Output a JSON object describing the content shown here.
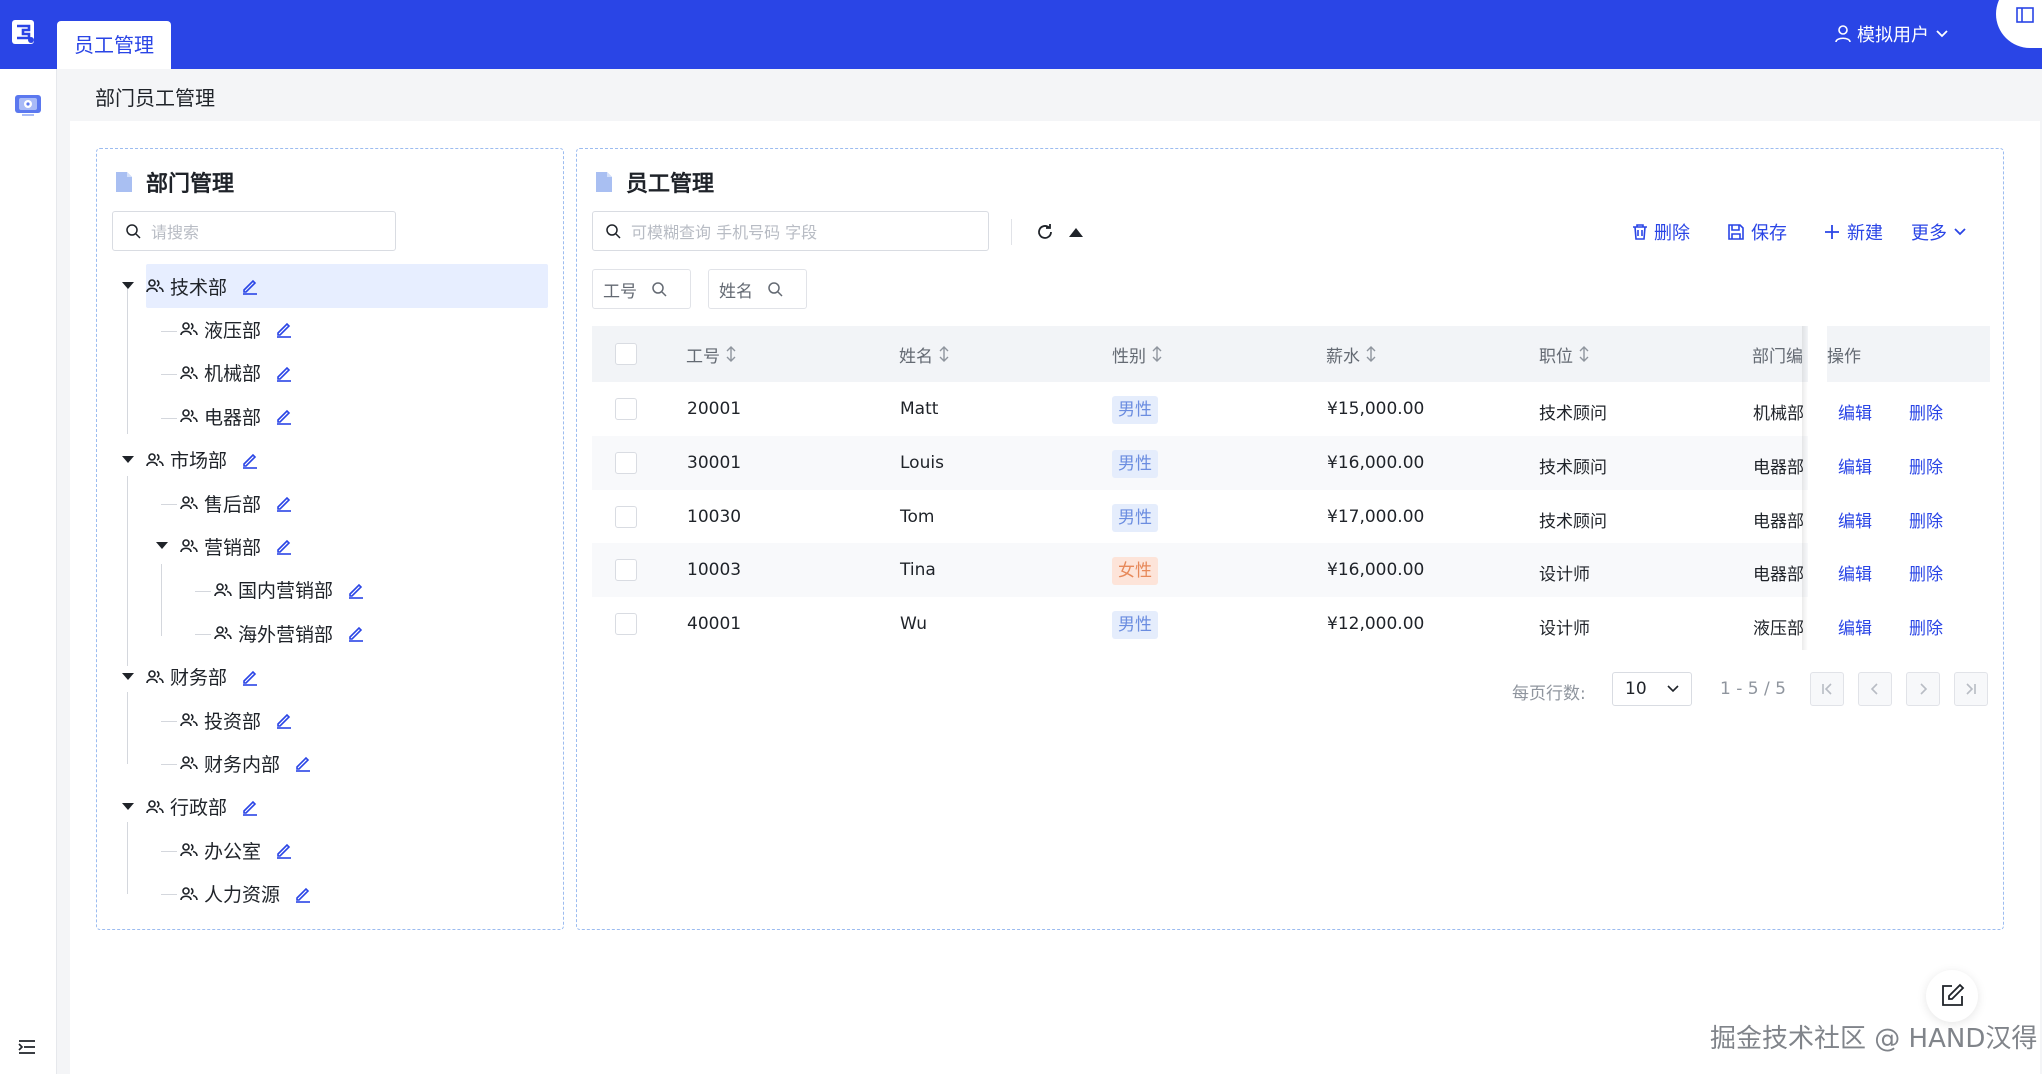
{
  "header": {
    "tab": "员工管理",
    "user": "模拟用户"
  },
  "breadcrumb": "部门员工管理",
  "dept_panel": {
    "title": "部门管理",
    "search_placeholder": "请搜索",
    "tree": [
      {
        "label": "技术部",
        "level": 0,
        "expanded": true,
        "selected": true
      },
      {
        "label": "液压部",
        "level": 1
      },
      {
        "label": "机械部",
        "level": 1
      },
      {
        "label": "电器部",
        "level": 1
      },
      {
        "label": "市场部",
        "level": 0,
        "expanded": true
      },
      {
        "label": "售后部",
        "level": 1
      },
      {
        "label": "营销部",
        "level": 1,
        "expanded": true
      },
      {
        "label": "国内营销部",
        "level": 2
      },
      {
        "label": "海外营销部",
        "level": 2
      },
      {
        "label": "财务部",
        "level": 0,
        "expanded": true
      },
      {
        "label": "投资部",
        "level": 1
      },
      {
        "label": "财务内部",
        "level": 1
      },
      {
        "label": "行政部",
        "level": 0,
        "expanded": true
      },
      {
        "label": "办公室",
        "level": 1
      },
      {
        "label": "人力资源",
        "level": 1
      }
    ]
  },
  "emp_panel": {
    "title": "员工管理",
    "search_placeholder": "可模糊查询 手机号码 字段",
    "toolbar": {
      "delete": "删除",
      "save": "保存",
      "new": "新建",
      "more": "更多"
    },
    "filters": {
      "id": "工号",
      "name": "姓名"
    },
    "columns": {
      "id": "工号",
      "name": "姓名",
      "gender": "性别",
      "salary": "薪水",
      "position": "职位",
      "dept": "部门编",
      "actions": "操作"
    },
    "rows": [
      {
        "id": "20001",
        "name": "Matt",
        "gender": "男性",
        "salary": "¥15,000.00",
        "position": "技术顾问",
        "dept": "机械部",
        "edit": "编辑",
        "delete": "删除"
      },
      {
        "id": "30001",
        "name": "Louis",
        "gender": "男性",
        "salary": "¥16,000.00",
        "position": "技术顾问",
        "dept": "电器部",
        "edit": "编辑",
        "delete": "删除"
      },
      {
        "id": "10030",
        "name": "Tom",
        "gender": "男性",
        "salary": "¥17,000.00",
        "position": "技术顾问",
        "dept": "电器部",
        "edit": "编辑",
        "delete": "删除"
      },
      {
        "id": "10003",
        "name": "Tina",
        "gender": "女性",
        "salary": "¥16,000.00",
        "position": "设计师",
        "dept": "电器部",
        "edit": "编辑",
        "delete": "删除"
      },
      {
        "id": "40001",
        "name": "Wu",
        "gender": "男性",
        "salary": "¥12,000.00",
        "position": "设计师",
        "dept": "液压部",
        "edit": "编辑",
        "delete": "删除"
      }
    ],
    "pager": {
      "label": "每页行数:",
      "page_size": "10",
      "range": "1 - 5 / 5"
    }
  },
  "watermark": "掘金技术社区 @ HAND汉得",
  "colors": {
    "primary": "#2a45e6",
    "selected_bg": "#e7eeff",
    "male_tag": "#e5edfc",
    "female_tag": "#fde4d9"
  }
}
